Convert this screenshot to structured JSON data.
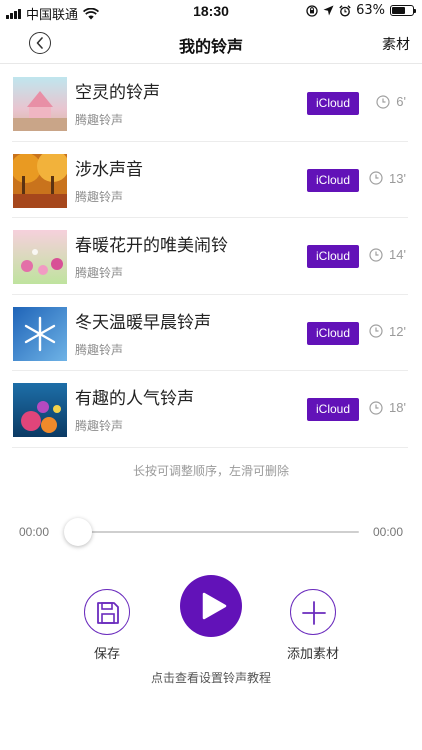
{
  "status_bar": {
    "carrier": "中国联通",
    "time": "18:30",
    "battery": "63%",
    "battery_level": 0.63,
    "icons": [
      "signal-icon",
      "wifi-icon",
      "lock-rotation-icon",
      "location-icon",
      "alarm-icon",
      "battery-icon"
    ]
  },
  "nav": {
    "back_icon": "chevron-left-icon",
    "title": "我的铃声",
    "right_label": "素材"
  },
  "ringtones": [
    {
      "title": "空灵的铃声",
      "subtitle": "腾趣铃声",
      "badge": "iCloud",
      "duration": "6'",
      "thumb": "pink-pavilion"
    },
    {
      "title": "涉水声音",
      "subtitle": "腾趣铃声",
      "badge": "iCloud",
      "duration": "13'",
      "thumb": "autumn-trees"
    },
    {
      "title": "春暖花开的唯美闹铃",
      "subtitle": "腾趣铃声",
      "badge": "iCloud",
      "duration": "14'",
      "thumb": "spring-flowers"
    },
    {
      "title": "冬天温暖早晨铃声",
      "subtitle": "腾趣铃声",
      "badge": "iCloud",
      "duration": "12'",
      "thumb": "snowflake"
    },
    {
      "title": "有趣的人气铃声",
      "subtitle": "腾趣铃声",
      "badge": "iCloud",
      "duration": "18'",
      "thumb": "coral-reef"
    }
  ],
  "hint": "长按可调整顺序，左滑可删除",
  "player": {
    "current_time": "00:00",
    "total_time": "00:00",
    "progress": 0,
    "save_label": "保存",
    "add_label": "添加素材",
    "tutorial_link": "点击查看设置铃声教程"
  },
  "colors": {
    "accent": "#6212b8",
    "badge_text": "#ffffff",
    "muted_text": "#8d8d8d"
  }
}
